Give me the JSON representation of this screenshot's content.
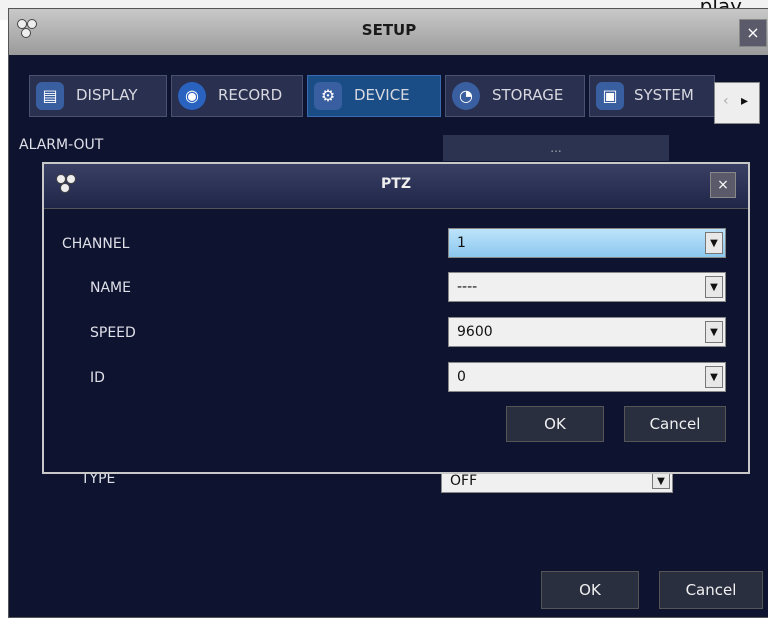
{
  "background_text": "play",
  "setup": {
    "title": "SETUP",
    "close_label": "×",
    "tabs": [
      {
        "label": "DISPLAY",
        "icon": "display-icon"
      },
      {
        "label": "RECORD",
        "icon": "record-icon"
      },
      {
        "label": "DEVICE",
        "icon": "device-gear-icon"
      },
      {
        "label": "STORAGE",
        "icon": "storage-icon"
      },
      {
        "label": "SYSTEM",
        "icon": "system-icon"
      }
    ],
    "scroll_left": "‹",
    "scroll_right": "▸",
    "alarm_out_label": "ALARM-OUT",
    "alarm_out_value": "...",
    "type_label": "TYPE",
    "type_value": "OFF",
    "ok_label": "OK",
    "cancel_label": "Cancel"
  },
  "ptz": {
    "title": "PTZ",
    "close_label": "×",
    "channel_label": "CHANNEL",
    "channel_value": "1",
    "name_label": "NAME",
    "name_value": "----",
    "speed_label": "SPEED",
    "speed_value": "9600",
    "id_label": "ID",
    "id_value": "0",
    "ok_label": "OK",
    "cancel_label": "Cancel"
  },
  "colors": {
    "window_bg": "#0e1330",
    "active_tab": "#1a4d86",
    "selected_field": "#9dd3f5"
  }
}
